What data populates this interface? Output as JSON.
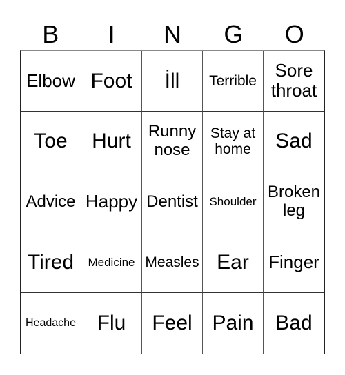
{
  "header": {
    "letters": [
      "B",
      "I",
      "N",
      "G",
      "O"
    ]
  },
  "board": {
    "rows": [
      [
        "Elbow",
        "Foot",
        "İll",
        "Terrible",
        "Sore throat"
      ],
      [
        "Toe",
        "Hurt",
        "Runny nose",
        "Stay at home",
        "Sad"
      ],
      [
        "Advice",
        "Happy",
        "Dentist",
        "Shoulder",
        "Broken leg"
      ],
      [
        "Tired",
        "Medicine",
        "Measles",
        "Ear",
        "Finger"
      ],
      [
        "Headache",
        "Flu",
        "Feel",
        "Pain",
        "Bad"
      ]
    ]
  }
}
